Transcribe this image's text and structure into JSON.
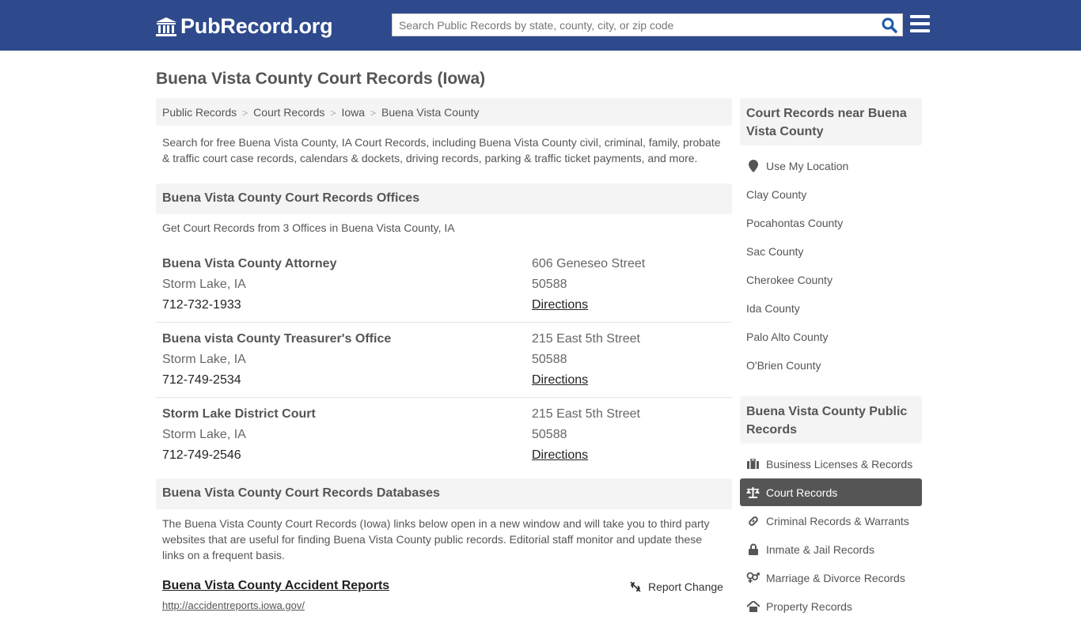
{
  "header": {
    "logo_text": "PubRecord.org",
    "search_placeholder": "Search Public Records by state, county, city, or zip code"
  },
  "page": {
    "title": "Buena Vista County Court Records (Iowa)",
    "breadcrumb": [
      "Public Records",
      "Court Records",
      "Iowa",
      "Buena Vista County"
    ],
    "intro": "Search for free Buena Vista County, IA Court Records, including Buena Vista County civil, criminal, family, probate & traffic court case records, calendars & dockets, driving records, parking & traffic ticket payments, and more."
  },
  "offices": {
    "heading": "Buena Vista County Court Records Offices",
    "subtitle": "Get Court Records from 3 Offices in Buena Vista County, IA",
    "items": [
      {
        "name": "Buena Vista County Attorney",
        "city": "Storm Lake, IA",
        "phone": "712-732-1933",
        "address": "606 Geneseo Street",
        "zip": "50588",
        "directions": "Directions"
      },
      {
        "name": "Buena vista County Treasurer's Office",
        "city": "Storm Lake, IA",
        "phone": "712-749-2534",
        "address": "215 East 5th Street",
        "zip": "50588",
        "directions": "Directions"
      },
      {
        "name": "Storm Lake District Court",
        "city": "Storm Lake, IA",
        "phone": "712-749-2546",
        "address": "215 East 5th Street",
        "zip": "50588",
        "directions": "Directions"
      }
    ]
  },
  "databases": {
    "heading": "Buena Vista County Court Records Databases",
    "intro": "The Buena Vista County Court Records (Iowa) links below open in a new window and will take you to third party websites that are useful for finding Buena Vista County public records. Editorial staff monitor and update these links on a frequent basis.",
    "items": [
      {
        "title": "Buena Vista County Accident Reports",
        "url": "http://accidentreports.iowa.gov/",
        "report_label": "Report Change"
      }
    ]
  },
  "sidebar": {
    "nearby": {
      "heading": "Court Records near Buena Vista County",
      "use_location": "Use My Location",
      "counties": [
        "Clay County",
        "Pocahontas County",
        "Sac County",
        "Cherokee County",
        "Ida County",
        "Palo Alto County",
        "O'Brien County"
      ]
    },
    "public_records": {
      "heading": "Buena Vista County Public Records",
      "items": [
        {
          "label": "Business Licenses & Records",
          "icon": "briefcase-icon",
          "active": false
        },
        {
          "label": "Court Records",
          "icon": "scales-icon",
          "active": true
        },
        {
          "label": "Criminal Records & Warrants",
          "icon": "link-icon",
          "active": false
        },
        {
          "label": "Inmate & Jail Records",
          "icon": "lock-icon",
          "active": false
        },
        {
          "label": "Marriage & Divorce Records",
          "icon": "gender-icon",
          "active": false
        },
        {
          "label": "Property Records",
          "icon": "home-icon",
          "active": false
        }
      ]
    }
  },
  "colors": {
    "header_bg": "#2e4a8c",
    "active_item_bg": "#555555",
    "panel_bg": "#f4f4f4"
  }
}
